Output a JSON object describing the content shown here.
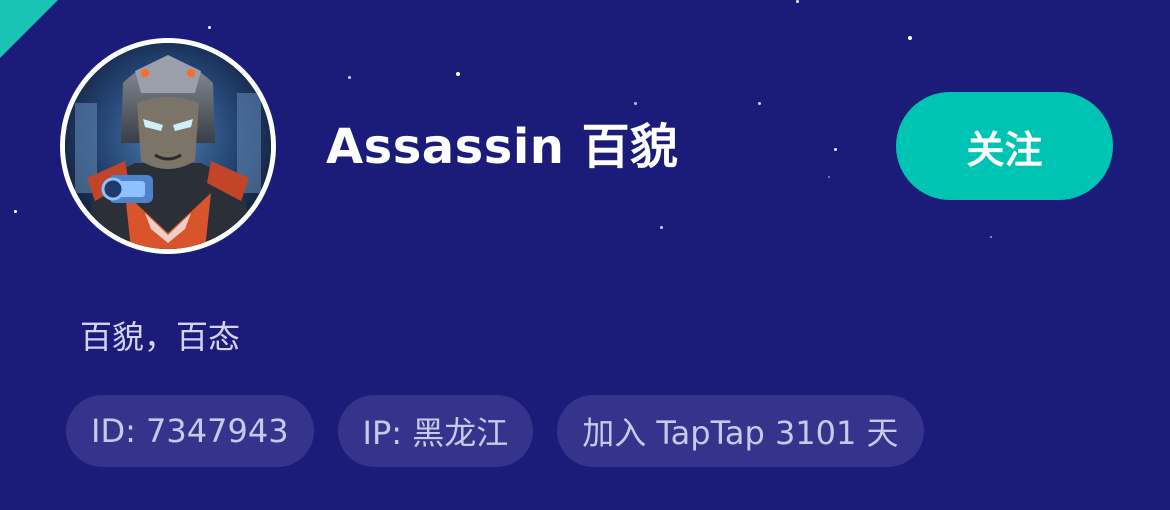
{
  "profile": {
    "username": "Assassin 百貌",
    "follow_label": "关注",
    "bio": "百貌，百态",
    "tags": {
      "id": "ID: 7347943",
      "ip": "IP: 黑龙江",
      "joined": "加入 TapTap 3101 天"
    },
    "avatar_icon": "robot-warrior-avatar-icon"
  },
  "colors": {
    "background": "#1b1b7a",
    "accent": "#00c4b3",
    "tag_bg": "#34348c",
    "tag_text": "#c8c9ea"
  }
}
